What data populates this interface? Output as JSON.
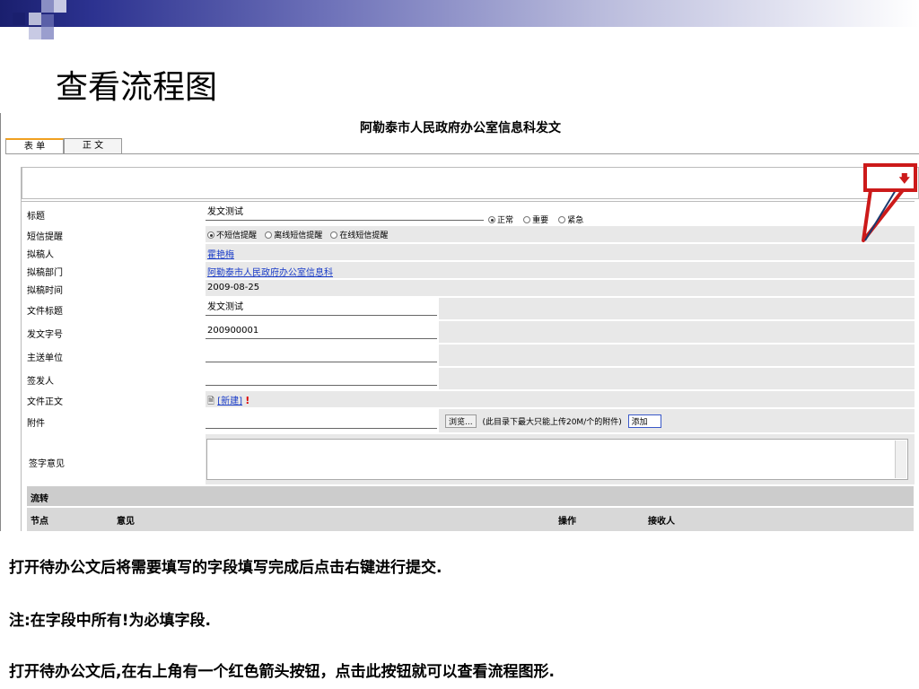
{
  "slide": {
    "title": "查看流程图",
    "notes": [
      "打开待办公文后将需要填写的字段填写完成后点击右键进行提交.",
      "注:在字段中所有!为必填字段.",
      "打开待办公文后,在右上角有一个红色箭头按钮，点击此按钮就可以查看流程图形."
    ]
  },
  "app": {
    "doc_title": "阿勒泰市人民政府办公室信息科发文",
    "tabs": [
      {
        "label": "表 单",
        "active": true
      },
      {
        "label": "正 文",
        "active": false
      }
    ],
    "flow_button_icon": "red-down-arrow-icon",
    "fields": {
      "title": {
        "label": "标题",
        "value": "发文测试",
        "priority_options": [
          "正常",
          "重要",
          "紧急"
        ],
        "priority_selected": "正常"
      },
      "sms": {
        "label": "短信提醒",
        "options": [
          "不短信提醒",
          "离线短信提醒",
          "在线短信提醒"
        ],
        "selected": "不短信提醒"
      },
      "drafter": {
        "label": "拟稿人",
        "value": "霍艳梅"
      },
      "dept": {
        "label": "拟稿部门",
        "value": "阿勒泰市人民政府办公室信息科"
      },
      "time": {
        "label": "拟稿时间",
        "value": "2009-08-25"
      },
      "file_title": {
        "label": "文件标题",
        "value": "发文测试"
      },
      "doc_no": {
        "label": "发文字号",
        "value": "200900001"
      },
      "main_unit": {
        "label": "主送单位",
        "value": ""
      },
      "signer": {
        "label": "签发人",
        "value": ""
      },
      "body": {
        "label": "文件正文",
        "new_label": "[新建]",
        "required_mark": "!"
      },
      "attachment": {
        "label": "附件",
        "browse_label": "浏览...",
        "hint": "(此目录下最大只能上传20M/个的附件)",
        "add_label": "添加"
      },
      "opinion": {
        "label": "签字意见"
      }
    },
    "flow": {
      "section_label": "流转",
      "columns": [
        "节点",
        "意见",
        "操作",
        "接收人"
      ]
    }
  },
  "colors": {
    "accent_red": "#cc1a1a",
    "link_blue": "#1a3cc8",
    "tab_accent": "#f0a020"
  }
}
